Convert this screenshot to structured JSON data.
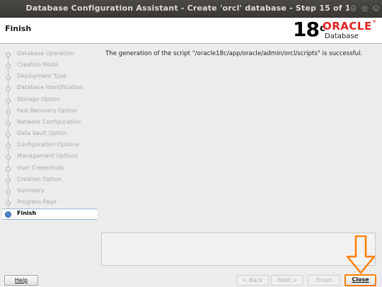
{
  "window": {
    "title": "Database Configuration Assistant - Create 'orcl' database - Step 15 of 15"
  },
  "header": {
    "heading": "Finish",
    "version": "18",
    "version_suffix": "c",
    "brand": "ORACLE",
    "brand_mark": "®",
    "product": "Database"
  },
  "steps": [
    {
      "label": "Database Operation"
    },
    {
      "label": "Creation Mode"
    },
    {
      "label": "Deployment Type"
    },
    {
      "label": "Database Identification"
    },
    {
      "label": "Storage Option"
    },
    {
      "label": "Fast Recovery Option"
    },
    {
      "label": "Network Configuration"
    },
    {
      "label": "Data Vault Option"
    },
    {
      "label": "Configuration Options"
    },
    {
      "label": "Management Options"
    },
    {
      "label": "User Credentials"
    },
    {
      "label": "Creation Option"
    },
    {
      "label": "Summary"
    },
    {
      "label": "Progress Page"
    },
    {
      "label": "Finish"
    }
  ],
  "active_step": "Finish",
  "main": {
    "message": "The generation of the script \"/oracle18c/app/oracle/admin/orcl/scripts\" is successful."
  },
  "buttons": {
    "help": "Help",
    "back": "< Back",
    "next": "Next >",
    "finish": "Finish",
    "close": "Close"
  },
  "colors": {
    "accent_orange": "#ff7f00",
    "oracle_red": "#e4201f",
    "active_step_blue": "#4b84c8"
  }
}
